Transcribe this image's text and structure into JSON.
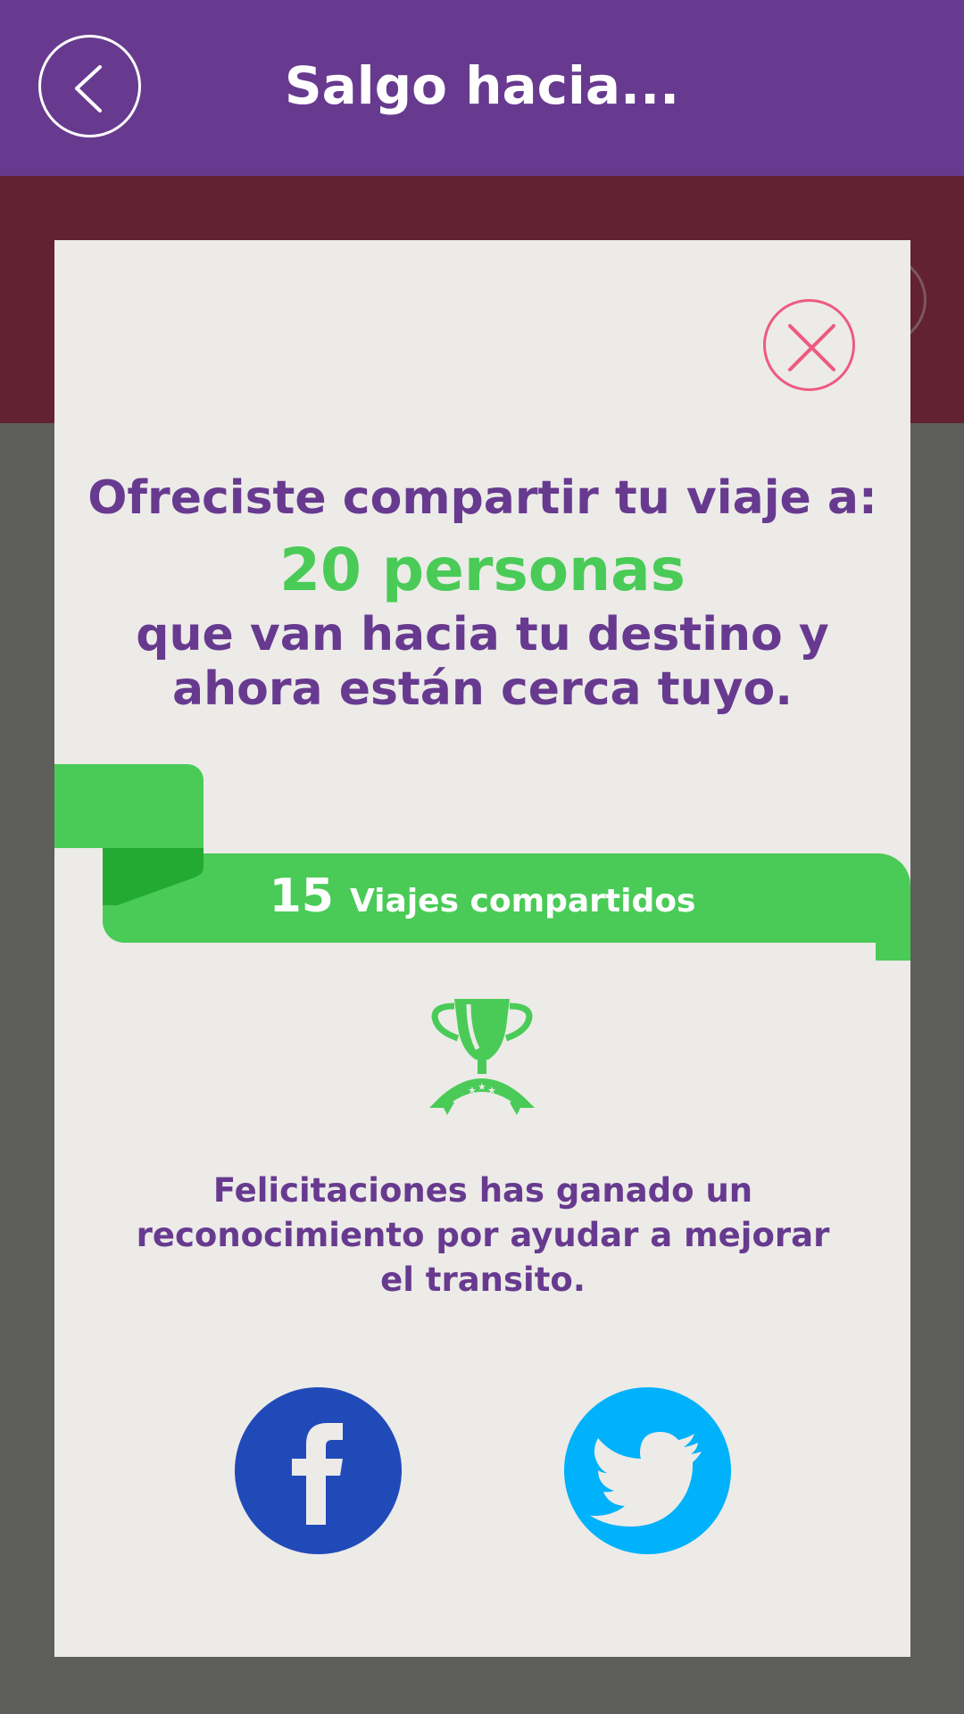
{
  "header": {
    "title": "Salgo hacia...",
    "back_icon": "chevron-left-icon",
    "background_color": "#673a8f"
  },
  "modal": {
    "close_icon": "close-icon",
    "headline": "Ofreciste compartir tu viaje a:",
    "people_count": "20 personas",
    "description_lines": [
      "que van hacia tu destino y",
      "ahora están cerca tuyo."
    ],
    "ribbon": {
      "count": "15",
      "label": "Viajes compartidos"
    },
    "trophy_icon": "trophy-icon",
    "congrats_text": "Felicitaciones has ganado un reconocimiento por ayudar a mejorar el transito.",
    "share": {
      "facebook_icon": "facebook-icon",
      "twitter_icon": "twitter-icon"
    }
  },
  "colors": {
    "purple": "#673a8f",
    "green": "#4acb57",
    "dark_green": "#22aa33",
    "close_pink": "#ee5a80",
    "facebook_blue": "#214ab9",
    "twitter_blue": "#00b1fb",
    "modal_bg": "#ecebe8",
    "overlay_gray": "#5e5e5c",
    "subbar_maroon": "#622232"
  }
}
